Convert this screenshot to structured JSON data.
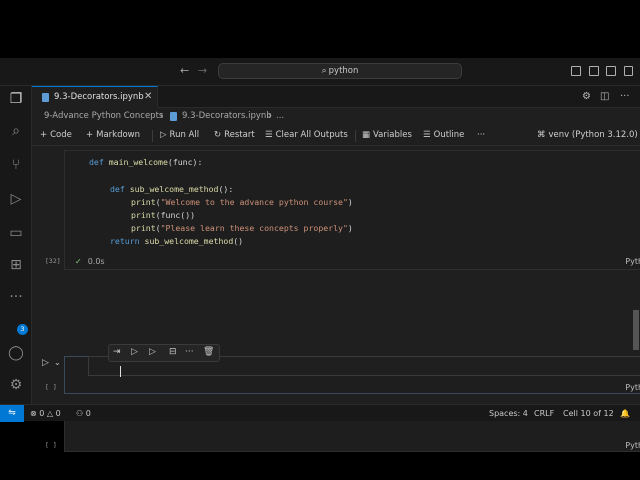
{
  "titlebar": {
    "search_text": "python"
  },
  "activity": {
    "extensions_badge": "3"
  },
  "tab": {
    "label": "9.3-Decorators.ipynb"
  },
  "breadcrumb": {
    "folder": "9-Advance Python Concepts",
    "file": "9.3-Decorators.ipynb",
    "more": "..."
  },
  "toolbar": {
    "code": "Code",
    "markdown": "Markdown",
    "run_all": "Run All",
    "restart": "Restart",
    "clear_all": "Clear All Outputs",
    "variables": "Variables",
    "outline": "Outline",
    "more": "···",
    "kernel": "venv (Python 3.12.0)"
  },
  "cells": {
    "cell1": {
      "exec_count": "[32]",
      "status": "0.0s",
      "language": "Python",
      "lines": {
        "l1_kw": "def",
        "l1_fn": "main_welcome",
        "l1_rest": "(func):",
        "l2_kw": "def",
        "l2_fn": "sub_welcome_method",
        "l2_rest": "():",
        "l3_fn": "print",
        "l3_str": "\"Welcome to the advance python course\"",
        "l4_fn": "print",
        "l4_rest": "(func())",
        "l5_fn": "print",
        "l5_str": "\"Please learn these concepts properly\"",
        "l6_kw": "return",
        "l6_fn": "sub_welcome_method",
        "l6_rest": "()"
      }
    },
    "cell2": {
      "exec_count": "[ ]",
      "language": "Python"
    },
    "cell3": {
      "exec_count": "[ ]",
      "language": "Python"
    }
  },
  "statusbar": {
    "errors": "0",
    "warnings": "0",
    "ports": "0",
    "spaces": "Spaces: 4",
    "eol": "CRLF",
    "cell_pos": "Cell 10 of 12"
  }
}
